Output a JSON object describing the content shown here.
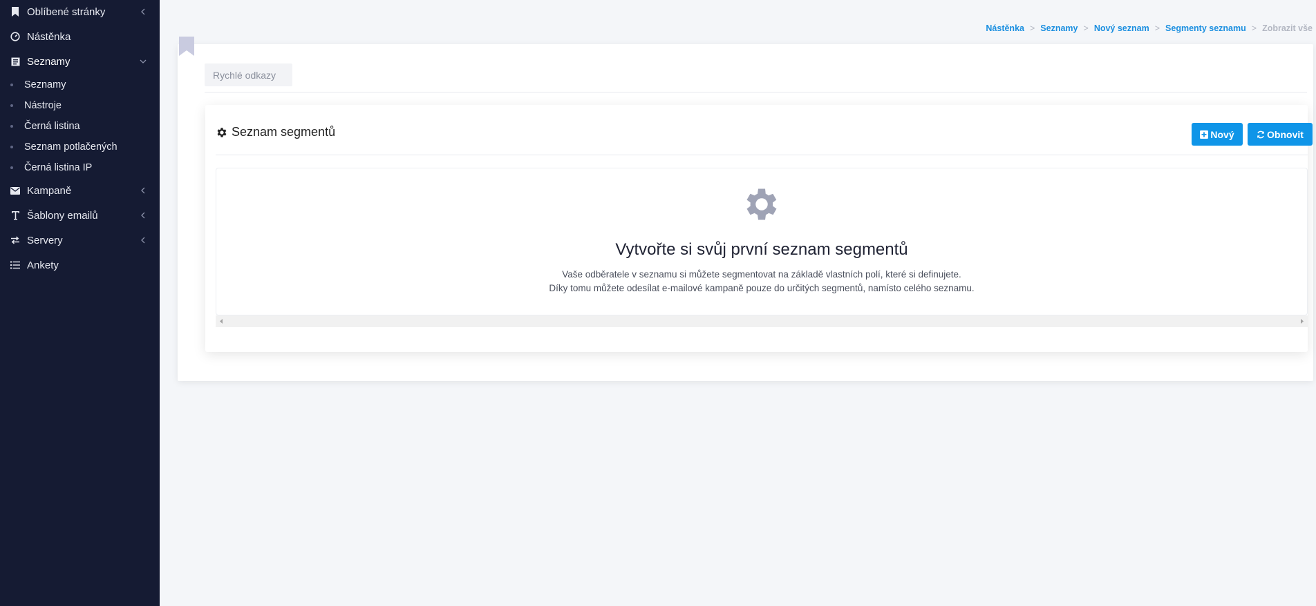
{
  "sidebar": {
    "items": [
      {
        "label": "Oblíbené stránky",
        "icon": "bookmark-icon"
      },
      {
        "label": "Nástěnka",
        "icon": "dashboard-icon"
      },
      {
        "label": "Seznamy",
        "icon": "list-book-icon"
      },
      {
        "label": "Kampaně",
        "icon": "envelope-icon"
      },
      {
        "label": "Šablony emailů",
        "icon": "text-icon"
      },
      {
        "label": "Servery",
        "icon": "exchange-icon"
      },
      {
        "label": "Ankety",
        "icon": "list-icon"
      }
    ],
    "subitems": [
      {
        "label": "Seznamy"
      },
      {
        "label": "Nástroje"
      },
      {
        "label": "Černá listina"
      },
      {
        "label": "Seznam potlačených"
      },
      {
        "label": "Černá listina IP"
      }
    ]
  },
  "breadcrumb": {
    "items": [
      "Nástěnka",
      "Seznamy",
      "Nový seznam",
      "Segmenty seznamu"
    ],
    "current": "Zobrazit vše",
    "separator": ">"
  },
  "quick_links": {
    "label": "Rychlé odkazy"
  },
  "section": {
    "title": "Seznam segmentů",
    "new_button": "Nový",
    "refresh_button": "Obnovit"
  },
  "empty_state": {
    "title": "Vytvořte si svůj první seznam segmentů",
    "line1": "Vaše odběratele v seznamu si můžete segmentovat na základě vlastních polí, které si definujete.",
    "line2": "Díky tomu můžete odesílat e-mailové kampaně pouze do určitých segmentů, namísto celého seznamu."
  },
  "colors": {
    "sidebar_bg": "#151b33",
    "accent": "#0f95e8",
    "link": "#1b8fe0",
    "page_bg": "#f4f6f9"
  }
}
